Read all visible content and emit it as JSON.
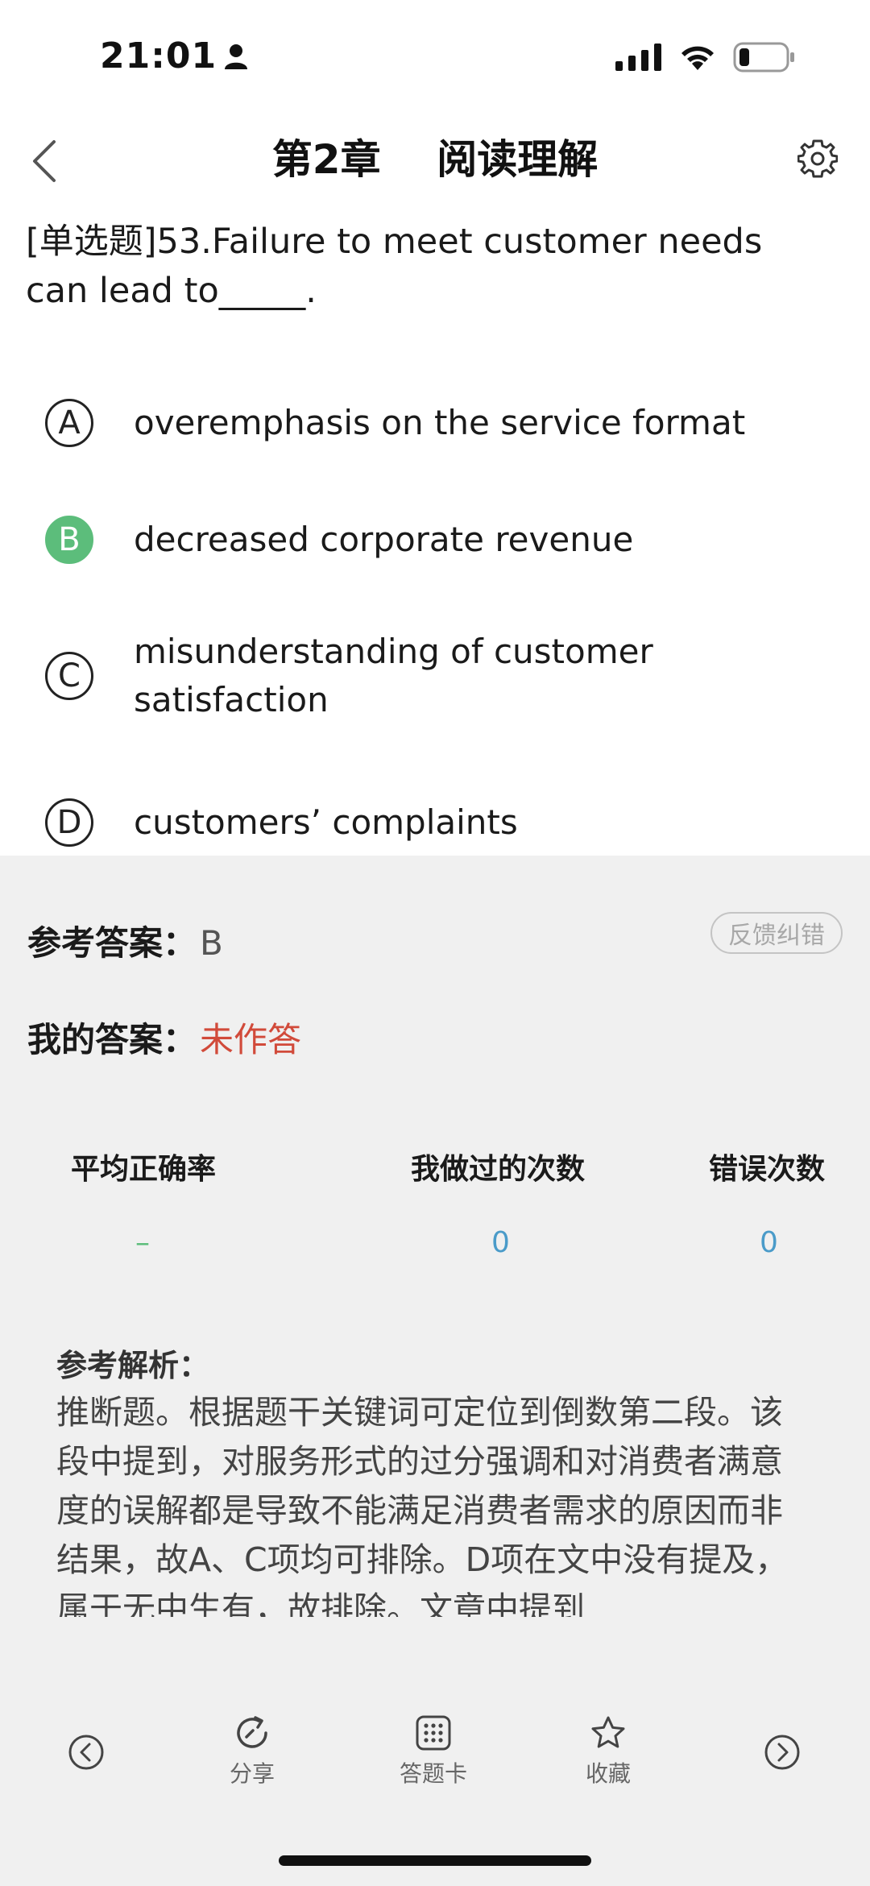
{
  "status_bar": {
    "time": "21:01",
    "icons": [
      "person-icon",
      "signal-icon",
      "wifi-icon",
      "battery-icon"
    ]
  },
  "nav": {
    "title": "第2章    阅读理解",
    "back_icon": "chevron-left-icon",
    "settings_icon": "gear-icon"
  },
  "question": {
    "text": "[单选题]53.Failure to meet customer needs can lead to_____."
  },
  "options": [
    {
      "letter": "A",
      "text": "overemphasis on the service format",
      "state": "default"
    },
    {
      "letter": "B",
      "text": "decreased corporate revenue",
      "state": "correct"
    },
    {
      "letter": "C",
      "text": "misunderstanding of customer satisfaction",
      "state": "default"
    },
    {
      "letter": "D",
      "text": "customers’ complaints",
      "state": "default"
    }
  ],
  "answer": {
    "ref_label": "参考答案：",
    "ref_value": "B",
    "feedback_label": "反馈纠错",
    "my_label": "我的答案：",
    "my_value": "未作答"
  },
  "stats": {
    "avg_label": "平均正确率",
    "avg_value": "–",
    "count_label": "我做过的次数",
    "count_value": "0",
    "error_label": "错误次数",
    "error_value": "0"
  },
  "analysis": {
    "title": "参考解析：",
    "text": "推断题。根据题干关键词可定位到倒数第二段。该段中提到，对服务形式的过分强调和对消费者满意度的误解都是导致不能满足消费者需求的原因而非结果，故A、C项均可排除。D项在文中没有提及，属于无中生有，故排除。文章中提到"
  },
  "toolbar": {
    "prev_icon": "chevron-left-circle-icon",
    "share_label": "分享",
    "card_label": "答题卡",
    "favorite_label": "收藏",
    "next_icon": "chevron-right-circle-icon"
  },
  "colors": {
    "correct": "#5cbd7b",
    "unanswered": "#d14a3a",
    "stat_blue": "#4a9bc9",
    "area_bg": "#f0f0f0"
  }
}
